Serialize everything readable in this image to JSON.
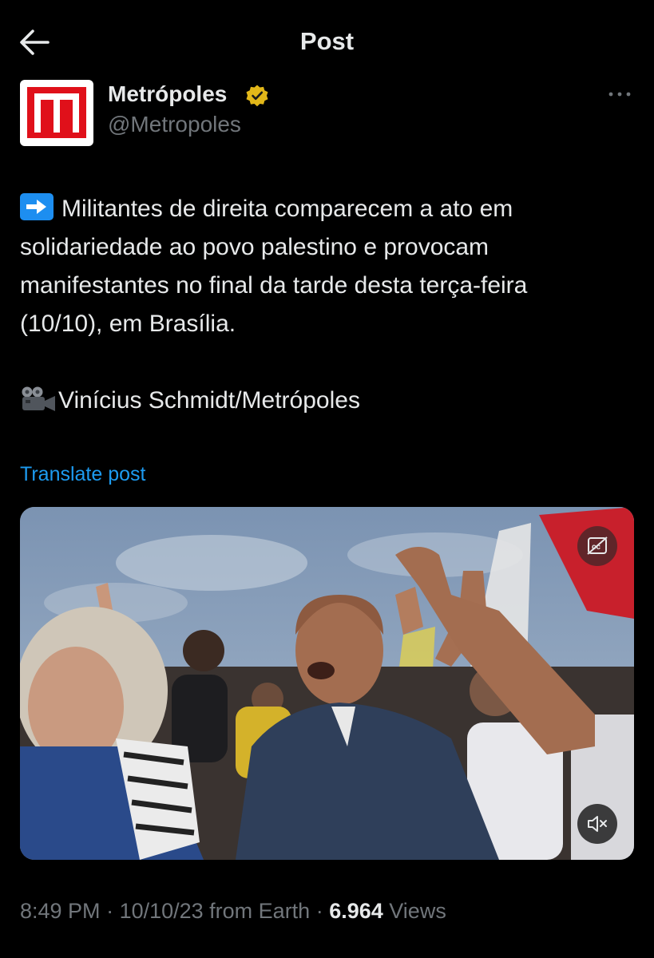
{
  "header": {
    "title": "Post"
  },
  "author": {
    "name": "Metrópoles",
    "handle": "@Metropoles",
    "verified": true
  },
  "post": {
    "lines": [
      "Militantes de direita comparecem a ato em",
      "solidariedade ao povo palestino e provocam",
      "manifestantes no final da tarde desta terça-feira",
      "(10/10), em Brasília."
    ],
    "credit": "Vinícius Schmidt/Metrópoles",
    "translate_label": "Translate post"
  },
  "meta": {
    "time": "8:49 PM",
    "sep1": " · ",
    "date": "10/10/23 from Earth",
    "sep2": " · ",
    "views_count": "6.964",
    "views_label": " Views"
  },
  "icons": [
    "back-arrow-icon",
    "verified-badge-icon",
    "more-icon",
    "right-arrow-emoji-icon",
    "movie-camera-emoji-icon",
    "captions-off-icon",
    "mute-icon"
  ],
  "colors": {
    "background": "#000000",
    "text": "#e7e9ea",
    "muted": "#71767b",
    "link": "#1d9bf0",
    "verified": "#e2b719",
    "brand_red": "#e0101a"
  }
}
